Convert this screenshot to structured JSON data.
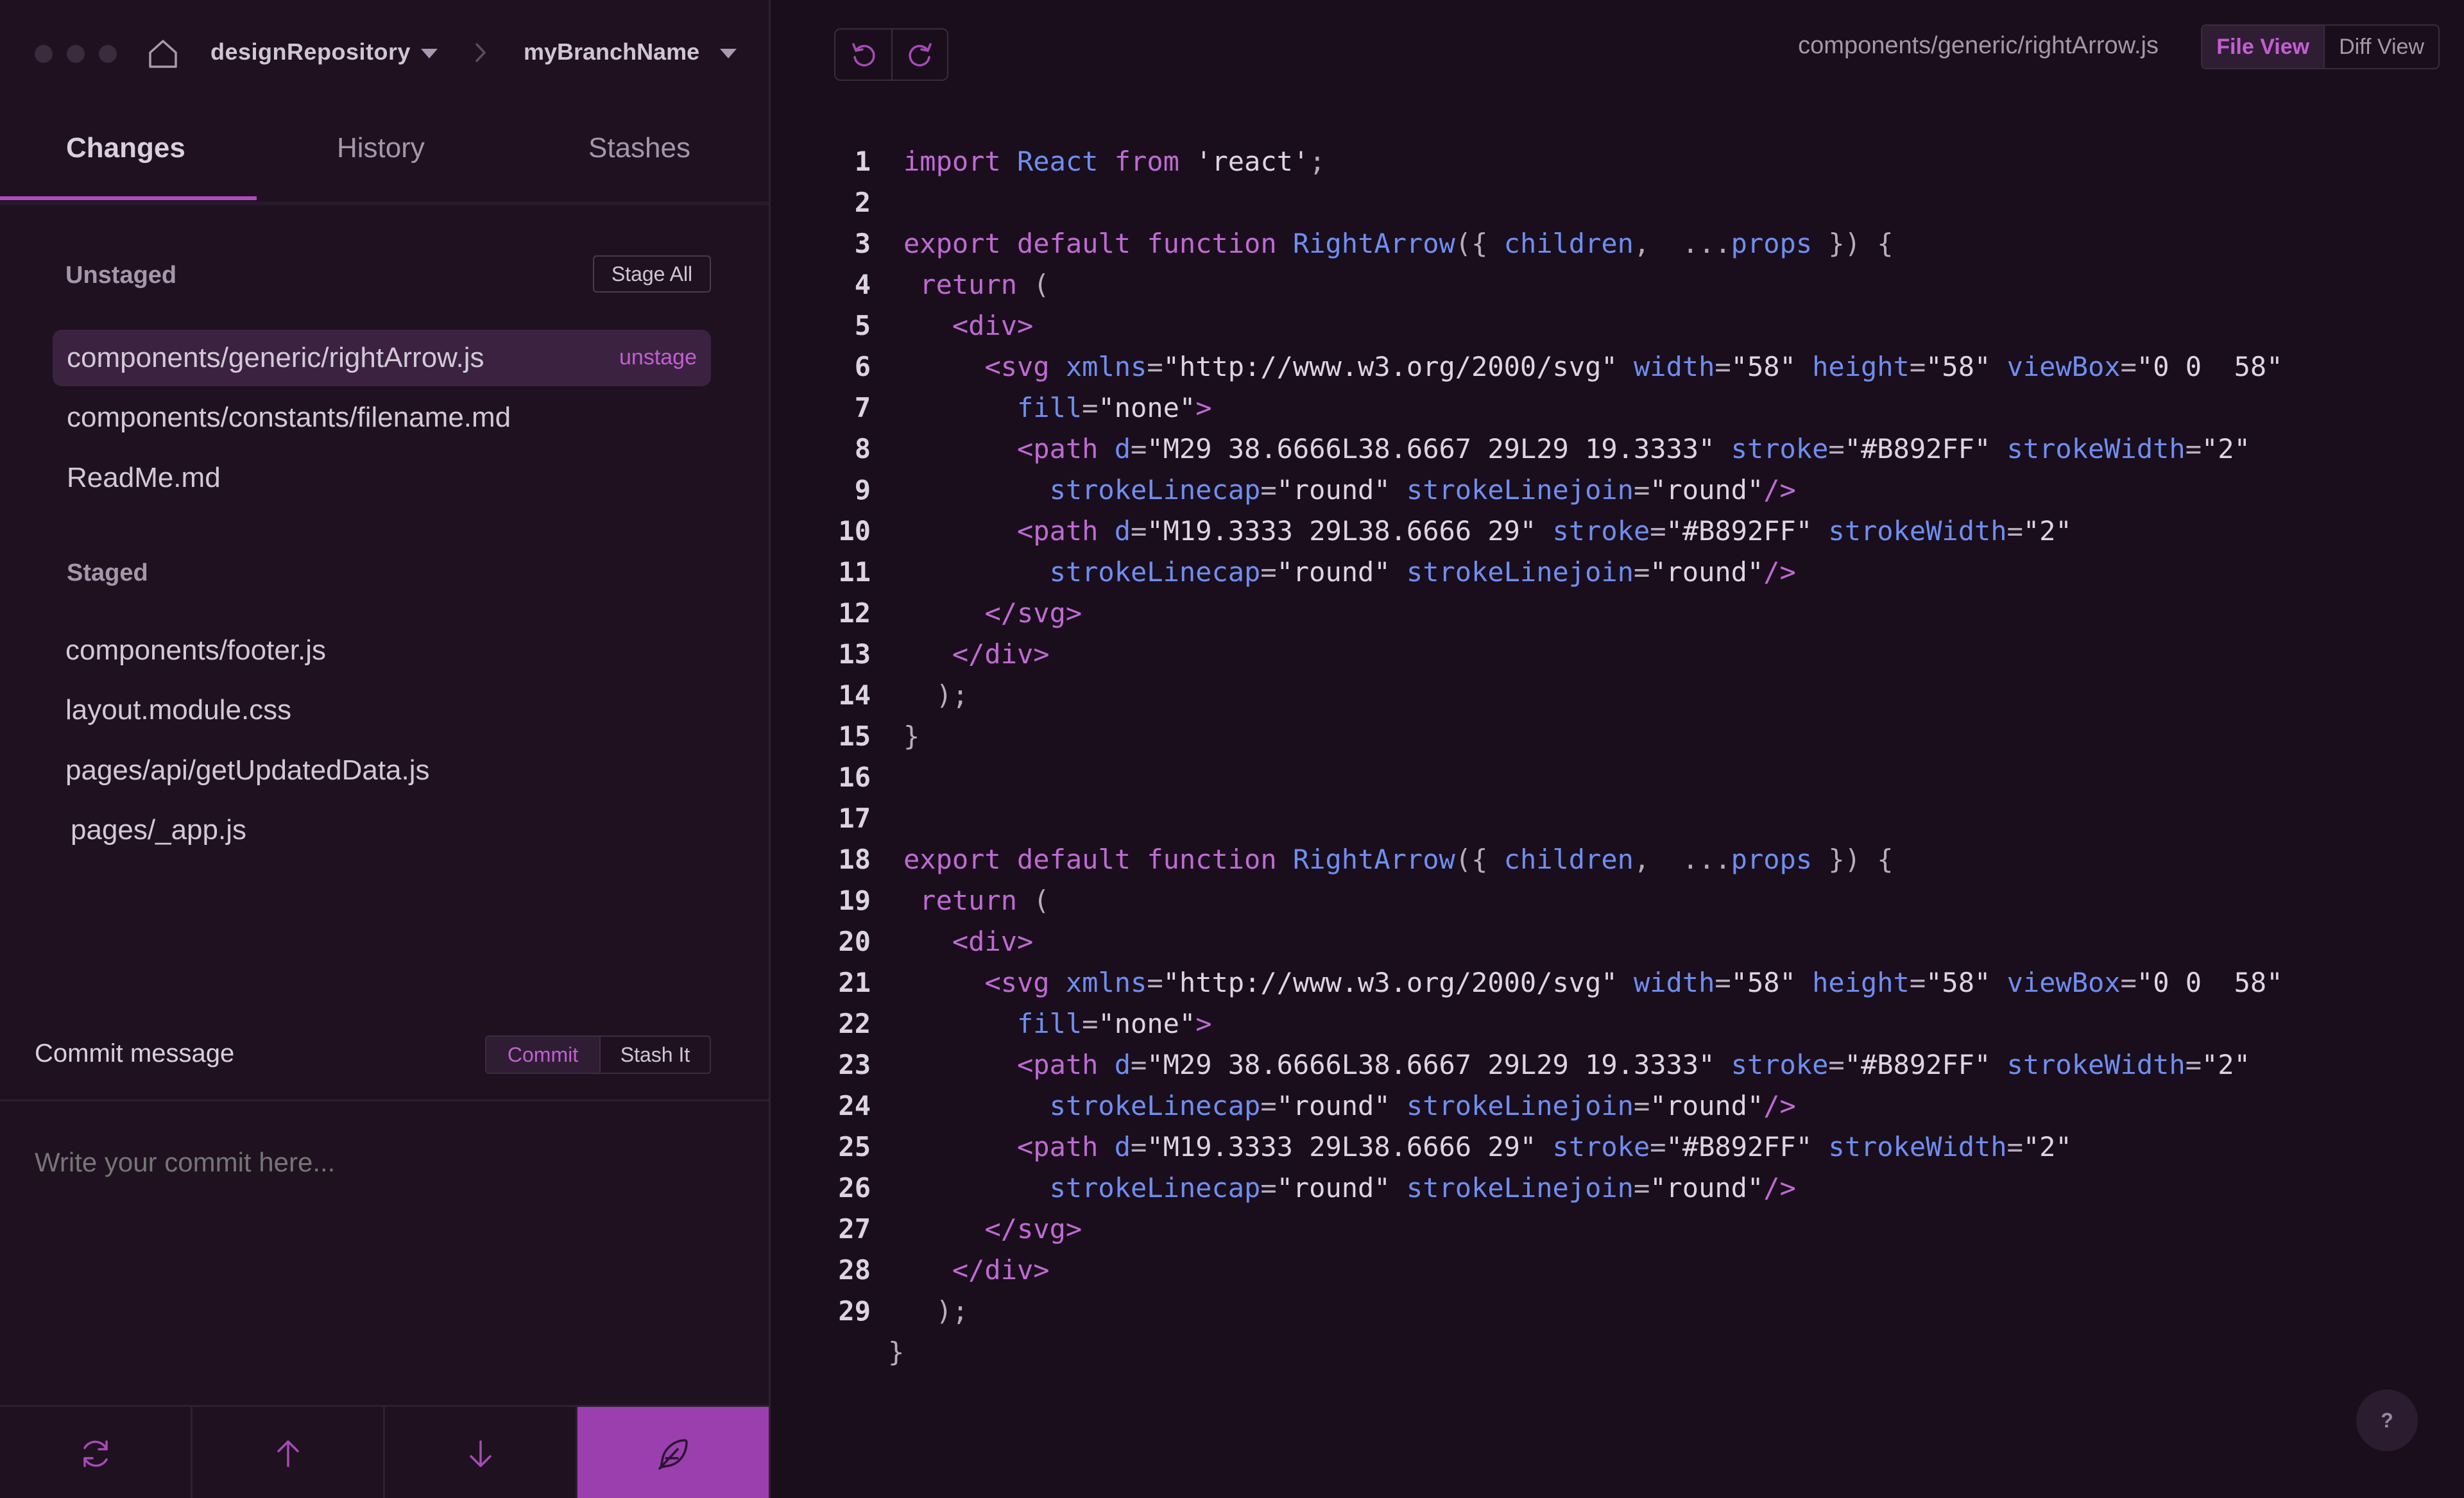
{
  "window": {
    "repo_name": "designRepository",
    "branch_name": "myBranchName"
  },
  "tabs": [
    {
      "label": "Changes",
      "active": true
    },
    {
      "label": "History",
      "active": false
    },
    {
      "label": "Stashes",
      "active": false
    }
  ],
  "unstaged": {
    "label": "Unstaged",
    "stage_all_label": "Stage All",
    "unstage_label": "unstage",
    "files": [
      {
        "name": "components/generic/rightArrow.js",
        "selected": true
      },
      {
        "name": "components/constants/filename.md",
        "selected": false
      },
      {
        "name": "ReadMe.md",
        "selected": false
      }
    ]
  },
  "staged": {
    "label": "Staged",
    "files": [
      {
        "name": "components/footer.js"
      },
      {
        "name": "layout.module.css"
      },
      {
        "name": "pages/api/getUpdatedData.js"
      },
      {
        "name": "pages/_app.js"
      }
    ]
  },
  "commit": {
    "label": "Commit message",
    "commit_button": "Commit",
    "stash_button": "Stash It",
    "placeholder": "Write your commit here..."
  },
  "bottom_bar": {
    "icons": [
      "sync-icon",
      "push-up-arrow-icon",
      "pull-down-arrow-icon",
      "feather-commit-icon"
    ]
  },
  "editor": {
    "file_path": "components/generic/rightArrow.js",
    "file_view_label": "File View",
    "diff_view_label": "Diff View",
    "active_view": "File View",
    "help_label": "?",
    "lines": [
      "1",
      "2",
      "3",
      "4",
      "5",
      "6",
      "7",
      "8",
      "9",
      "10",
      "11",
      "12",
      "13",
      "14",
      "15",
      "16",
      "17",
      "18",
      "19",
      "20",
      "21",
      "22",
      "23",
      "24",
      "25",
      "26",
      "27",
      "28",
      "29"
    ],
    "code": [
      "import React from 'react';",
      "",
      "export default function RightArrow({ children,  ...props }) {",
      " return (",
      "   <div>",
      "     <svg xmlns=\"http://www.w3.org/2000/svg\" width=\"58\" height=\"58\" viewBox=\"0 0  58\"",
      "       fill=\"none\">",
      "       <path d=\"M29 38.6666L38.6667 29L29 19.3333\" stroke=\"#B892FF\" strokeWidth=\"2\"",
      "         strokeLinecap=\"round\" strokeLinejoin=\"round\"/>",
      "       <path d=\"M19.3333 29L38.6666 29\" stroke=\"#B892FF\" strokeWidth=\"2\"",
      "         strokeLinecap=\"round\" strokeLinejoin=\"round\"/>",
      "     </svg>",
      "   </div>",
      "  );",
      "}",
      "",
      "",
      "export default function RightArrow({ children,  ...props }) {",
      " return (",
      "   <div>",
      "     <svg xmlns=\"http://www.w3.org/2000/svg\" width=\"58\" height=\"58\" viewBox=\"0 0  58\"",
      "       fill=\"none\">",
      "       <path d=\"M29 38.6666L38.6667 29L29 19.3333\" stroke=\"#B892FF\" strokeWidth=\"2\"",
      "         strokeLinecap=\"round\" strokeLinejoin=\"round\"/>",
      "       <path d=\"M19.3333 29L38.6666 29\" stroke=\"#B892FF\" strokeWidth=\"2\"",
      "         strokeLinecap=\"round\" strokeLinejoin=\"round\"/>",
      "     </svg>",
      "   </div>",
      "  );",
      "}"
    ]
  },
  "colors": {
    "accent": "#B04AC0",
    "keyword": "#C06AD4",
    "attribute": "#6F8EF0"
  }
}
